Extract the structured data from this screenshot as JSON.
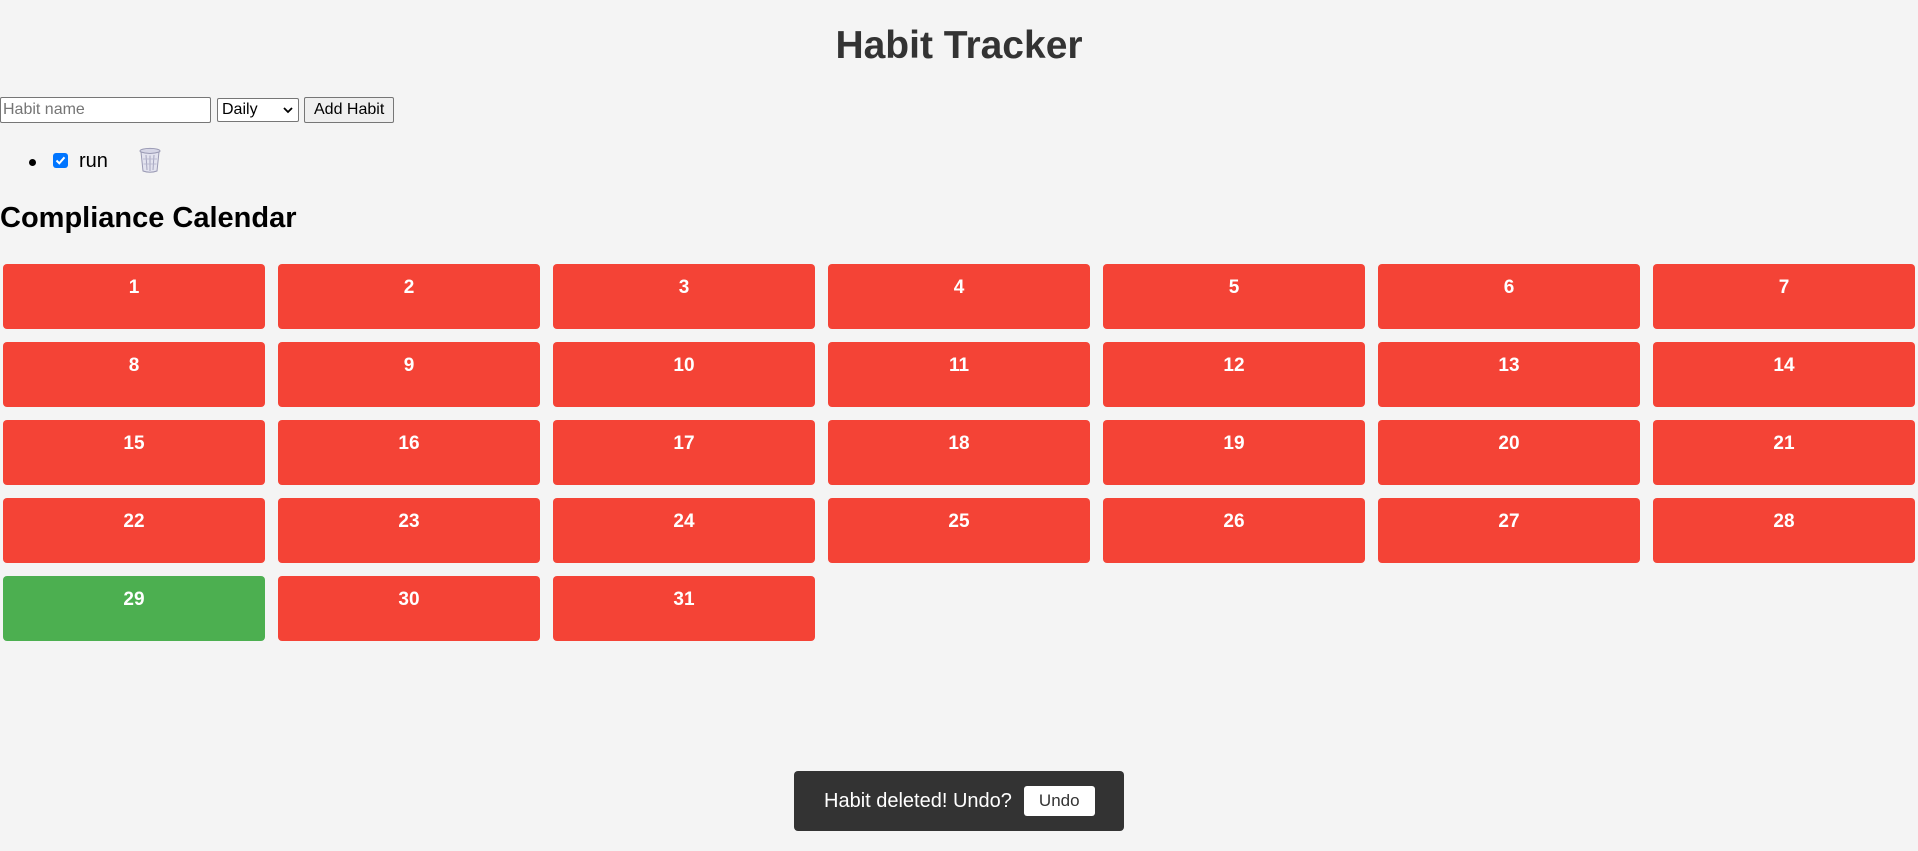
{
  "header": {
    "title": "Habit Tracker"
  },
  "form": {
    "input_placeholder": "Habit name",
    "input_value": "",
    "frequency_selected": "Daily",
    "add_button_label": "Add Habit"
  },
  "habits": [
    {
      "name": "run",
      "checked": true,
      "delete_icon": "trash-icon"
    }
  ],
  "calendar": {
    "title": "Compliance Calendar",
    "days": [
      {
        "label": "1",
        "status": "missed"
      },
      {
        "label": "2",
        "status": "missed"
      },
      {
        "label": "3",
        "status": "missed"
      },
      {
        "label": "4",
        "status": "missed"
      },
      {
        "label": "5",
        "status": "missed"
      },
      {
        "label": "6",
        "status": "missed"
      },
      {
        "label": "7",
        "status": "missed"
      },
      {
        "label": "8",
        "status": "missed"
      },
      {
        "label": "9",
        "status": "missed"
      },
      {
        "label": "10",
        "status": "missed"
      },
      {
        "label": "11",
        "status": "missed"
      },
      {
        "label": "12",
        "status": "missed"
      },
      {
        "label": "13",
        "status": "missed"
      },
      {
        "label": "14",
        "status": "missed"
      },
      {
        "label": "15",
        "status": "missed"
      },
      {
        "label": "16",
        "status": "missed"
      },
      {
        "label": "17",
        "status": "missed"
      },
      {
        "label": "18",
        "status": "missed"
      },
      {
        "label": "19",
        "status": "missed"
      },
      {
        "label": "20",
        "status": "missed"
      },
      {
        "label": "21",
        "status": "missed"
      },
      {
        "label": "22",
        "status": "missed"
      },
      {
        "label": "23",
        "status": "missed"
      },
      {
        "label": "24",
        "status": "missed"
      },
      {
        "label": "25",
        "status": "missed"
      },
      {
        "label": "26",
        "status": "missed"
      },
      {
        "label": "27",
        "status": "missed"
      },
      {
        "label": "28",
        "status": "missed"
      },
      {
        "label": "29",
        "status": "done"
      },
      {
        "label": "30",
        "status": "missed"
      },
      {
        "label": "31",
        "status": "missed"
      }
    ]
  },
  "toast": {
    "message": "Habit deleted! Undo?",
    "button_label": "Undo"
  },
  "colors": {
    "missed": "#f44336",
    "done": "#4caf50",
    "background": "#f4f4f4",
    "toast_bg": "#333333",
    "checkbox": "#0075ff"
  }
}
